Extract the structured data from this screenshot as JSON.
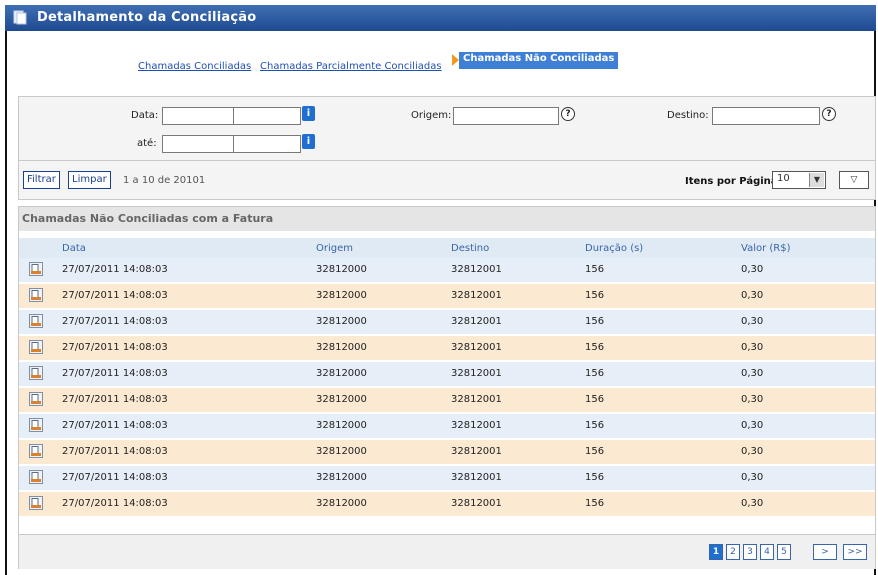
{
  "window": {
    "title": "Detalhamento da Conciliação",
    "title_icon": "document-icon"
  },
  "tabs": {
    "conciliadas": "Chamadas Conciliadas",
    "parciais": "Chamadas Parcialmente Conciliadas",
    "nao_conciliadas": "Chamadas Não Conciliadas",
    "active": "nao_conciliadas"
  },
  "filters": {
    "data_label": "Data:",
    "ate_label": "até:",
    "origem_label": "Origem:",
    "destino_label": "Destino:",
    "data_from_date": "",
    "data_from_time": "",
    "data_to_date": "",
    "data_to_time": "",
    "origem_value": "",
    "destino_value": "",
    "calendar_icon": "calendar-icon",
    "help_icon": "help-icon"
  },
  "toolbar": {
    "filtrar": "Filtrar",
    "limpar": "Limpar",
    "count_text": "1 a 10 de 20101",
    "items_per_page_label": "Itens por Página:",
    "items_per_page_value": "10"
  },
  "section": {
    "title": "Chamadas Não Conciliadas com a Fatura"
  },
  "table": {
    "columns": [
      "Data",
      "Origem",
      "Destino",
      "Duração (s)",
      "Valor (R$)"
    ],
    "rows": [
      {
        "data": "27/07/2011 14:08:03",
        "origem": "32812000",
        "destino": "32812001",
        "duracao": "156",
        "valor": "0,30"
      },
      {
        "data": "27/07/2011 14:08:03",
        "origem": "32812000",
        "destino": "32812001",
        "duracao": "156",
        "valor": "0,30"
      },
      {
        "data": "27/07/2011 14:08:03",
        "origem": "32812000",
        "destino": "32812001",
        "duracao": "156",
        "valor": "0,30"
      },
      {
        "data": "27/07/2011 14:08:03",
        "origem": "32812000",
        "destino": "32812001",
        "duracao": "156",
        "valor": "0,30"
      },
      {
        "data": "27/07/2011 14:08:03",
        "origem": "32812000",
        "destino": "32812001",
        "duracao": "156",
        "valor": "0,30"
      },
      {
        "data": "27/07/2011 14:08:03",
        "origem": "32812000",
        "destino": "32812001",
        "duracao": "156",
        "valor": "0,30"
      },
      {
        "data": "27/07/2011 14:08:03",
        "origem": "32812000",
        "destino": "32812001",
        "duracao": "156",
        "valor": "0,30"
      },
      {
        "data": "27/07/2011 14:08:03",
        "origem": "32812000",
        "destino": "32812001",
        "duracao": "156",
        "valor": "0,30"
      },
      {
        "data": "27/07/2011 14:08:03",
        "origem": "32812000",
        "destino": "32812001",
        "duracao": "156",
        "valor": "0,30"
      },
      {
        "data": "27/07/2011 14:08:03",
        "origem": "32812000",
        "destino": "32812001",
        "duracao": "156",
        "valor": "0,30"
      }
    ],
    "row_icon": "call-detail-icon"
  },
  "pagination": {
    "pages": [
      "1",
      "2",
      "3",
      "4",
      "5"
    ],
    "current": "1",
    "next": ">",
    "last": ">>"
  },
  "colors": {
    "title_bar": "#1e4a91",
    "active_tab": "#3f7fd6",
    "row_even": "#e6eff8",
    "row_odd": "#fbe9d2",
    "header": "#dfeaf5"
  }
}
